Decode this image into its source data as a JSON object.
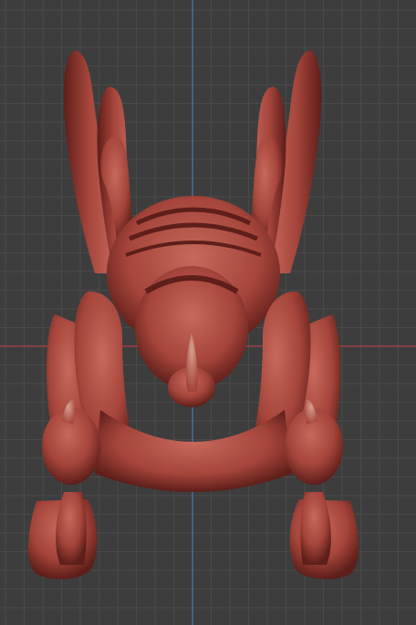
{
  "viewport": {
    "background_color": "#3d3d3d",
    "grid_color": "#4a4a4a",
    "grid_major_color": "#4f4f4f",
    "x_axis_color": "#b0404a",
    "y_axis_color": "#4a7ab8"
  },
  "model": {
    "material_color": "#a4443a",
    "shadow_color": "#5e1e19",
    "highlight_color": "#c8695c",
    "horn_tip_color": "#d7a08f"
  }
}
